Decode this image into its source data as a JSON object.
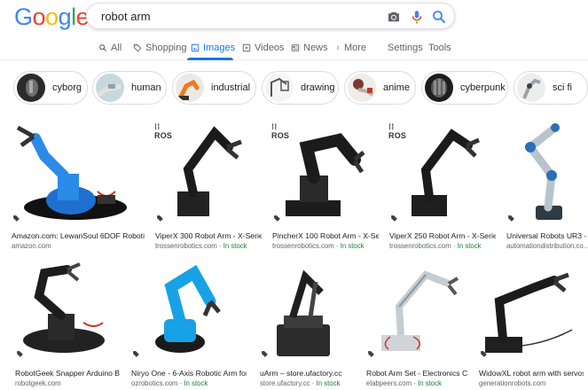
{
  "logo": {
    "letters": [
      "G",
      "o",
      "o",
      "g",
      "l",
      "e"
    ],
    "colors": [
      "#4285f4",
      "#ea4335",
      "#fbbc05",
      "#4285f4",
      "#34a853",
      "#ea4335"
    ]
  },
  "search": {
    "query": "robot arm"
  },
  "tabs": [
    {
      "label": "All",
      "icon": "search-icon"
    },
    {
      "label": "Shopping",
      "icon": "tag-icon"
    },
    {
      "label": "Images",
      "icon": "image-icon",
      "active": true
    },
    {
      "label": "Videos",
      "icon": "play-icon"
    },
    {
      "label": "News",
      "icon": "newspaper-icon"
    },
    {
      "label": "More",
      "icon": "more-vert-icon"
    }
  ],
  "tools": {
    "settings": "Settings",
    "tools": "Tools"
  },
  "chips": [
    {
      "label": "cyborg"
    },
    {
      "label": "human"
    },
    {
      "label": "industrial"
    },
    {
      "label": "drawing"
    },
    {
      "label": "anime"
    },
    {
      "label": "cyberpunk"
    },
    {
      "label": "sci fi"
    }
  ],
  "results_row1": [
    {
      "title": "Amazon.com: LewanSoul 6DOF Robotic ...",
      "source": "amazon.com",
      "stock": ""
    },
    {
      "title": "ViperX 300 Robot Arm - X-Serie...",
      "source": "trossenrobotics.com",
      "stock": "In stock",
      "badge": "ROS"
    },
    {
      "title": "PincherX 100 Robot Arm - X-Serie...",
      "source": "trossenrobotics.com",
      "stock": "In stock",
      "badge": "ROS"
    },
    {
      "title": "ViperX 250 Robot Arm - X-Serie...",
      "source": "trossenrobotics.com",
      "stock": "In stock",
      "badge": "ROS"
    },
    {
      "title": "Universal Robots UR3 - Li...",
      "source": "automationdistribution.co...",
      "stock": ""
    }
  ],
  "results_row2": [
    {
      "title": "RobotGeek Snapper Arduino Ba...",
      "source": "robotgeek.com",
      "stock": ""
    },
    {
      "title": "Niryo One - 6-Axis Robotic Arm for ...",
      "source": "ozrobotics.com",
      "stock": "In stock"
    },
    {
      "title": "uArm – store.ufactory.cc",
      "source": "store.ufactory.cc",
      "stock": "In stock"
    },
    {
      "title": "Robot Arm Set - Electronics C...",
      "source": "elabpeers.com",
      "stock": "In stock"
    },
    {
      "title": "WidowXL robot arm with servos",
      "source": "generationrobots.com",
      "stock": ""
    }
  ],
  "colors": {
    "accent": "#1a73e8",
    "in_stock": "#188038",
    "muted": "#5f6368"
  }
}
